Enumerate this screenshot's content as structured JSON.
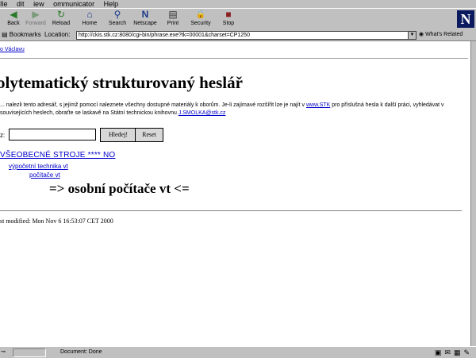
{
  "menu": [
    "Ile",
    "dit",
    "iew",
    "ommunicator",
    "Help"
  ],
  "toolbar": {
    "buttons": [
      {
        "label": "Back",
        "icon": "back-arrow-icon",
        "glyph": "◀"
      },
      {
        "label": "Forward",
        "icon": "forward-arrow-icon",
        "glyph": "▶"
      },
      {
        "label": "Reload",
        "icon": "reload-icon",
        "glyph": "↻"
      },
      {
        "label": "Home",
        "icon": "home-icon",
        "glyph": "⌂"
      },
      {
        "label": "Search",
        "icon": "search-icon",
        "glyph": "⚲"
      },
      {
        "label": "Netscape",
        "icon": "netscape-icon",
        "glyph": "N"
      },
      {
        "label": "Print",
        "icon": "print-icon",
        "glyph": "▤"
      },
      {
        "label": "Security",
        "icon": "security-lock-icon",
        "glyph": "🔒"
      },
      {
        "label": "Stop",
        "icon": "stop-icon",
        "glyph": "■"
      }
    ],
    "logo": "N"
  },
  "location": {
    "bookmarks_label": "Bookmarks",
    "location_label": "Location:",
    "url": "http://ckis.stk.cz:8080/cgi-bin/phrase.exe?tk=00001&charset=CP1250",
    "related_label": "What's Related"
  },
  "page": {
    "top_link": "o Václavu",
    "title": "olytematický strukturovaný heslář",
    "paragraph_before": "... nalezli tento adresář, s jejímž pomocí naleznete všechny dostupné materiály k oborům. Je-li zajímavé rozšířit lze je najít v ",
    "paragraph_link": "www.STK",
    "paragraph_after": " pro příslušná hesla k další práci, vyhledávat v souvisejících heslech, obraťte se laskavě na Státní technickou knihovnu ",
    "paragraph_email": "J.SMOLKA@stk.cz",
    "search_label": "z:",
    "search_value": "",
    "search_button": "Hledej!",
    "reset_button": "Reset",
    "breadcrumb": "VŠEOBECNÉ STROJE **** NO",
    "tree_level1": "výpočetní technika vt",
    "tree_level2": "počítače vt",
    "current_term": "=> osobní počítače vt <=",
    "last_modified": "st modified: Mon Nov 6 16:53:07 CET 2000"
  },
  "status": {
    "text": "Document: Done"
  }
}
